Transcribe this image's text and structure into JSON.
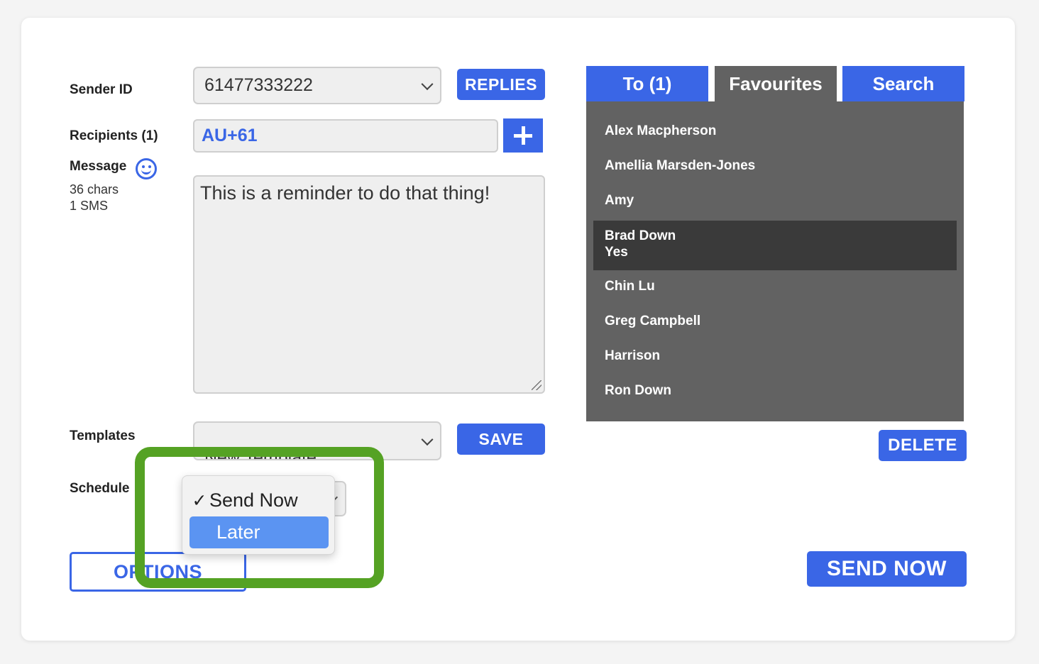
{
  "form": {
    "sender_id_label": "Sender ID",
    "sender_id_value": "61477333222",
    "replies_label": "REPLIES",
    "recipients_label": "Recipients (1)",
    "recipient_value": "AU+61",
    "message_label": "Message",
    "char_count": "36 chars",
    "sms_count": "1 SMS",
    "message_text": "This is a reminder to do that thing!",
    "templates_label": "Templates",
    "template_value": "New Template",
    "save_label": "SAVE",
    "schedule_label": "Schedule",
    "options_label": "OPTIONS",
    "send_now_label": "SEND NOW"
  },
  "schedule_menu": {
    "options": [
      {
        "label": "Send Now",
        "check": "✓",
        "selected": true
      },
      {
        "label": "Later",
        "check": "",
        "highlighted": true
      }
    ]
  },
  "contacts": {
    "tabs": [
      {
        "label": "To (1)"
      },
      {
        "label": "Favourites",
        "active": true
      },
      {
        "label": "Search"
      }
    ],
    "items": [
      {
        "name": "Alex Macpherson"
      },
      {
        "name": "Amellia Marsden-Jones"
      },
      {
        "name": "Amy"
      },
      {
        "name": "Brad Down",
        "detail": "Yes",
        "selected": true
      },
      {
        "name": "Chin Lu"
      },
      {
        "name": "Greg Campbell"
      },
      {
        "name": "Harrison"
      },
      {
        "name": "Ron Down"
      }
    ],
    "delete_label": "DELETE"
  },
  "colors": {
    "accent": "#3a66e6",
    "list_bg": "#626262",
    "list_selected": "#3a3a3a",
    "highlight_green": "#55a224",
    "menu_highlight": "#5b94f2"
  },
  "icons": {
    "emoji": "smiley-icon",
    "add": "plus-icon",
    "dropdown": "chevron-down-icon",
    "check": "checkmark-icon",
    "resize": "resize-handle-icon"
  }
}
